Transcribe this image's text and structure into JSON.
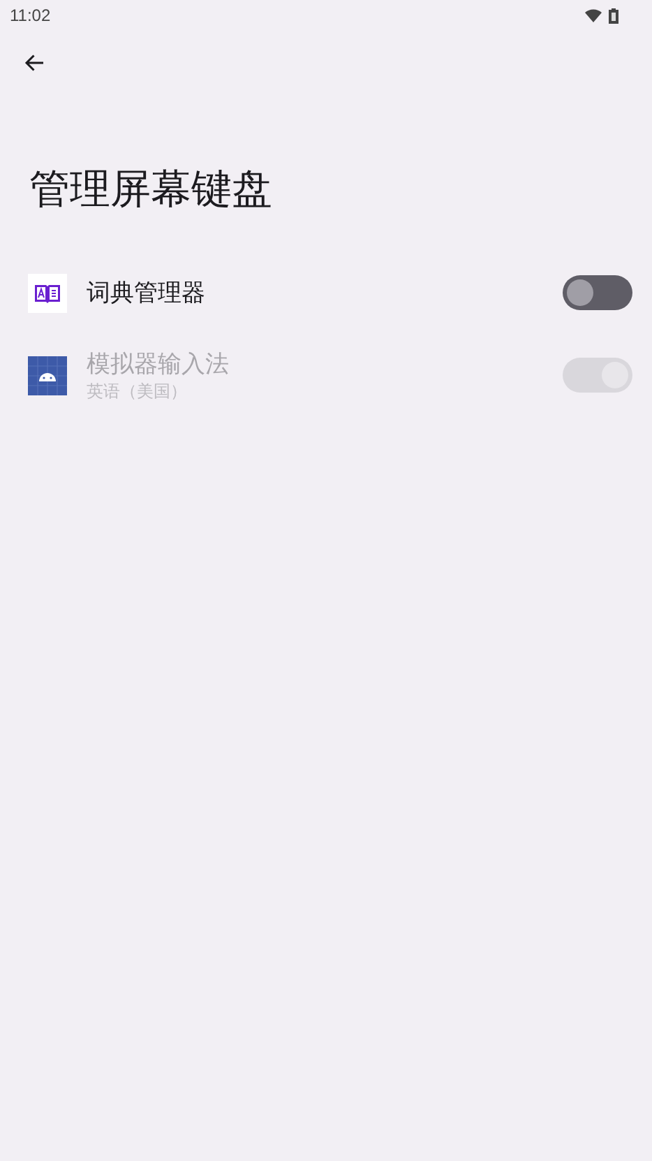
{
  "status_bar": {
    "time": "11:02"
  },
  "title": "管理屏幕键盘",
  "items": [
    {
      "kind": "dictionary",
      "title": "词典管理器",
      "on": false,
      "disabled": false
    },
    {
      "kind": "android",
      "title": "模拟器输入法",
      "subtitle": "英语（美国）",
      "on": true,
      "disabled": true
    }
  ]
}
